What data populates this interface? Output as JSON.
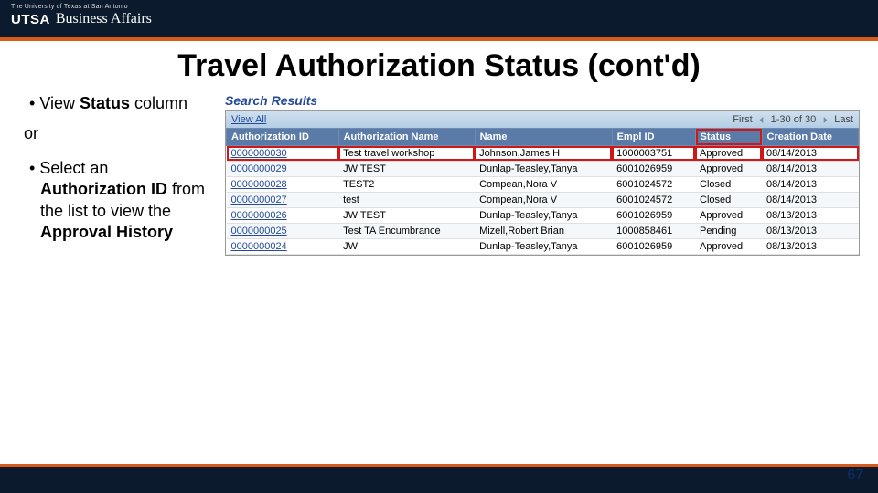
{
  "header": {
    "tagline": "The University of Texas at San Antonio",
    "logo_prefix": "UTSA",
    "logo_suffix": "Business Affairs"
  },
  "title": "Travel Authorization Status (cont'd)",
  "bullets": {
    "b1_part1": "View ",
    "b1_part2": "Status",
    "b1_part3": " column",
    "or": "or",
    "b2_part1": "Select an ",
    "b2_part2": "Authorization ID",
    "b2_part3": " from the list to view the ",
    "b2_part4": "Approval History"
  },
  "search": {
    "label": "Search Results",
    "view_all": "View All",
    "first": "First",
    "range": "1-30 of 30",
    "last": "Last"
  },
  "columns": {
    "auth_id": "Authorization ID",
    "auth_name": "Authorization Name",
    "name": "Name",
    "empl_id": "Empl ID",
    "status": "Status",
    "creation": "Creation Date"
  },
  "rows": [
    {
      "auth_id": "0000000030",
      "auth_name": "Test travel workshop",
      "name": "Johnson,James H",
      "empl_id": "1000003751",
      "status": "Approved",
      "creation": "08/14/2013",
      "hl": true
    },
    {
      "auth_id": "0000000029",
      "auth_name": "JW TEST",
      "name": "Dunlap-Teasley,Tanya",
      "empl_id": "6001026959",
      "status": "Approved",
      "creation": "08/14/2013"
    },
    {
      "auth_id": "0000000028",
      "auth_name": "TEST2",
      "name": "Compean,Nora V",
      "empl_id": "6001024572",
      "status": "Closed",
      "creation": "08/14/2013"
    },
    {
      "auth_id": "0000000027",
      "auth_name": "test",
      "name": "Compean,Nora V",
      "empl_id": "6001024572",
      "status": "Closed",
      "creation": "08/14/2013"
    },
    {
      "auth_id": "0000000026",
      "auth_name": "JW TEST",
      "name": "Dunlap-Teasley,Tanya",
      "empl_id": "6001026959",
      "status": "Approved",
      "creation": "08/13/2013"
    },
    {
      "auth_id": "0000000025",
      "auth_name": "Test TA Encumbrance",
      "name": "Mizell,Robert Brian",
      "empl_id": "1000858461",
      "status": "Pending",
      "creation": "08/13/2013"
    },
    {
      "auth_id": "0000000024",
      "auth_name": "JW",
      "name": "Dunlap-Teasley,Tanya",
      "empl_id": "6001026959",
      "status": "Approved",
      "creation": "08/13/2013"
    }
  ],
  "page_number": "67"
}
